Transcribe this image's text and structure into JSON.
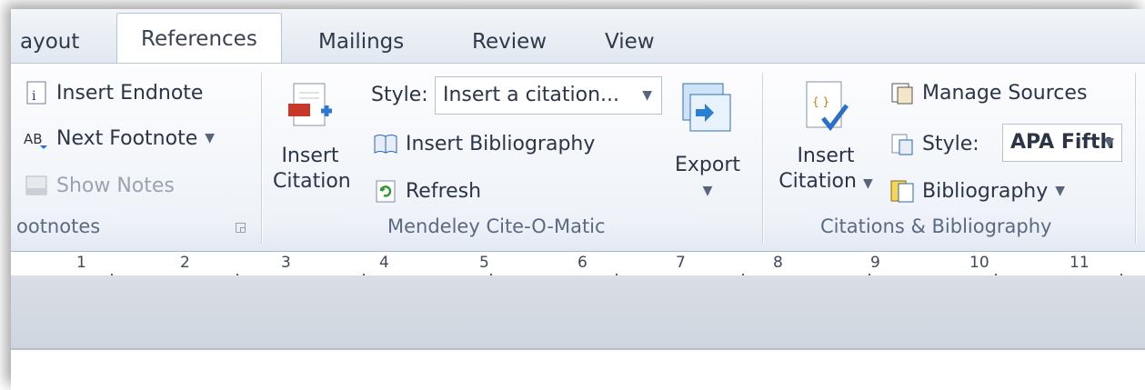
{
  "tabs": {
    "layout": "ayout",
    "references": "References",
    "mailings": "Mailings",
    "review": "Review",
    "view": "View"
  },
  "footnotes": {
    "insert_endnote": "Insert Endnote",
    "next_footnote": "Next Footnote",
    "show_notes": "Show Notes",
    "group_label": "ootnotes"
  },
  "mendeley": {
    "insert_citation_line1": "Insert",
    "insert_citation_line2": "Citation",
    "style_label": "Style:",
    "style_value": "Insert a citation...",
    "insert_bibliography": "Insert Bibliography",
    "refresh": "Refresh",
    "export": "Export",
    "group_label": "Mendeley Cite-O-Matic"
  },
  "citations": {
    "insert_citation_line1": "Insert",
    "insert_citation_line2": "Citation",
    "manage_sources": "Manage Sources",
    "style_label": "Style:",
    "style_value": "APA Fifth",
    "bibliography": "Bibliography",
    "group_label": "Citations & Bibliography"
  },
  "ruler": {
    "labels": [
      "1",
      "2",
      "3",
      "4",
      "5",
      "6",
      "7",
      "8",
      "9",
      "10",
      "11"
    ]
  }
}
